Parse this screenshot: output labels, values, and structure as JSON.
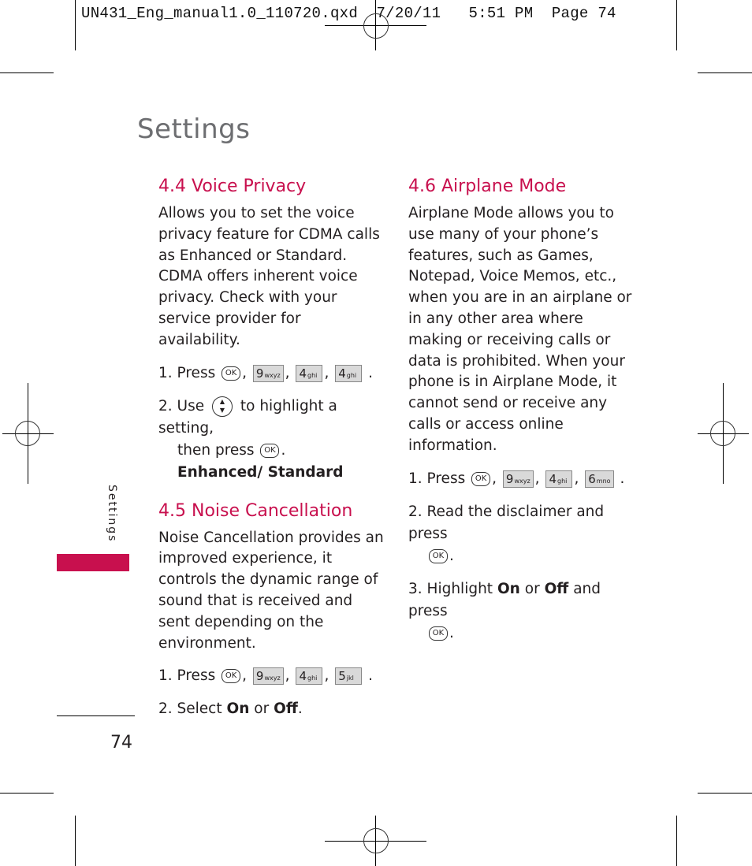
{
  "slug": {
    "filename": "UN431_Eng_manual1.0_110720.qxd",
    "date": "7/20/11",
    "time": "5:51 PM",
    "page": "Page 74"
  },
  "page_title": "Settings",
  "side_tab": {
    "label": "Settings",
    "color": "#c8104e"
  },
  "page_number": "74",
  "accent_color": "#c8104e",
  "sections": {
    "voice_privacy": {
      "heading": "4.4 Voice Privacy",
      "body": "Allows you to set the voice privacy feature for CDMA calls as Enhanced or Standard. CDMA offers inherent voice privacy. Check with your service provider for availability.",
      "step1_prefix": "1. Press",
      "step1_keys": [
        "OK",
        "9",
        "4",
        "4"
      ],
      "step1_key_subs": [
        "",
        "wxyz",
        "ghi",
        "ghi"
      ],
      "step2_prefix": "2. Use",
      "step2_icon": "nav-key-up-down",
      "step2_middle": "to highlight a setting,",
      "step2_then": "then press",
      "step2_key": "OK",
      "step2_options": "Enhanced/ Standard"
    },
    "noise_cancellation": {
      "heading": "4.5 Noise Cancellation",
      "body": "Noise Cancellation provides an improved experience, it controls the dynamic range of sound that is received and sent depending on the environment.",
      "step1_prefix": "1. Press",
      "step1_keys": [
        "OK",
        "9",
        "4",
        "5"
      ],
      "step1_key_subs": [
        "",
        "wxyz",
        "ghi",
        "jkl"
      ],
      "step2_prefix": "2. Select",
      "step2_on": "On",
      "step2_or": "or",
      "step2_off": "Off",
      "step2_end": "."
    },
    "airplane_mode": {
      "heading": "4.6 Airplane Mode",
      "body": "Airplane Mode allows you to use many of your phone’s features, such as Games, Notepad, Voice Memos, etc., when you are in an airplane or in any other area where making or receiving calls or data is prohibited. When your phone is in Airplane Mode, it cannot send or receive any calls or access online information.",
      "step1_prefix": "1. Press",
      "step1_keys": [
        "OK",
        "9",
        "4",
        "6"
      ],
      "step1_key_subs": [
        "",
        "wxyz",
        "ghi",
        "mno"
      ],
      "step2_text": "2. Read the disclaimer and press",
      "step2_key": "OK",
      "step3_prefix": "3. Highlight",
      "step3_on": "On",
      "step3_or": "or",
      "step3_off": "Off",
      "step3_suffix": "and press",
      "step3_key": "OK"
    }
  },
  "punct": {
    "comma": ",",
    "period": "."
  }
}
